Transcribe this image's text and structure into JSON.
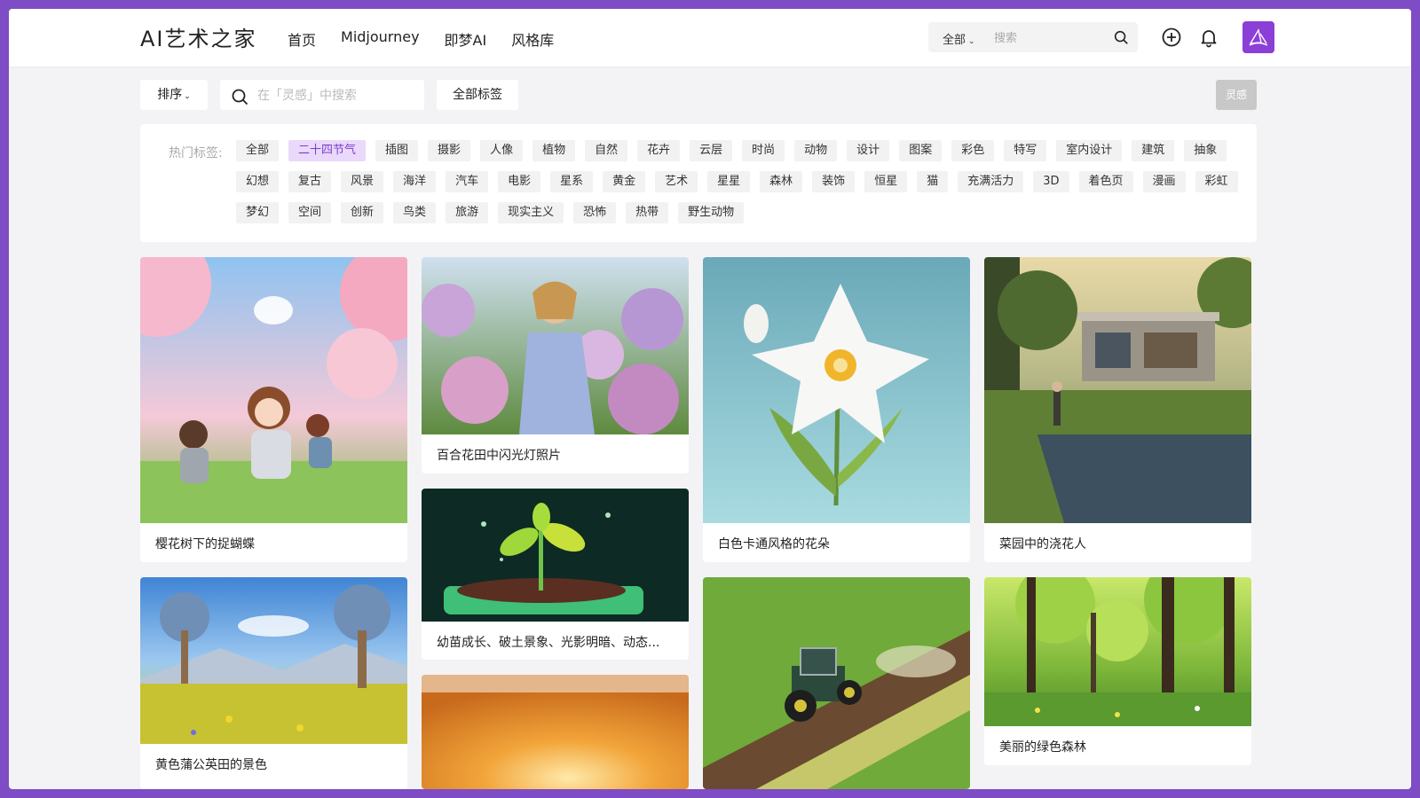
{
  "header": {
    "logo": "AI艺术之家",
    "nav": [
      "首页",
      "Midjourney",
      "即梦AI",
      "风格库"
    ],
    "search_scope": "全部",
    "search_placeholder": "搜索"
  },
  "toolbar": {
    "sort_label": "排序",
    "search_placeholder": "在「灵感」中搜索",
    "all_tags_label": "全部标签",
    "inspire_label": "灵感"
  },
  "tags": {
    "label": "热门标签:",
    "active": "二十四节气",
    "items": [
      "全部",
      "二十四节气",
      "插图",
      "摄影",
      "人像",
      "植物",
      "自然",
      "花卉",
      "云层",
      "时尚",
      "动物",
      "设计",
      "图案",
      "彩色",
      "特写",
      "室内设计",
      "建筑",
      "抽象",
      "幻想",
      "复古",
      "风景",
      "海洋",
      "汽车",
      "电影",
      "星系",
      "黄金",
      "艺术",
      "星星",
      "森林",
      "装饰",
      "恒星",
      "猫",
      "充满活力",
      "3D",
      "着色页",
      "漫画",
      "彩虹",
      "梦幻",
      "空间",
      "创新",
      "鸟类",
      "旅游",
      "现实主义",
      "恐怖",
      "热带",
      "野生动物"
    ]
  },
  "cards": [
    {
      "caption": "樱花树下的捉蝴蝶",
      "image": "cherry-blossom-children"
    },
    {
      "caption": "百合花田中闪光灯照片",
      "image": "woman-hydrangea-field"
    },
    {
      "caption": "幼苗成长、破土景象、光影明暗、动态...",
      "image": "seedling-on-phone"
    },
    {
      "caption": "",
      "image": "golden-sunlight-rain"
    },
    {
      "caption": "白色卡通风格的花朵",
      "image": "white-cartoon-flower"
    },
    {
      "caption": "",
      "image": "tractor-in-field"
    },
    {
      "caption": "菜园中的浇花人",
      "image": "garden-house-gardener"
    },
    {
      "caption": "美丽的绿色森林",
      "image": "green-forest"
    },
    {
      "caption": "黄色蒲公英田的景色",
      "image": "dandelion-field"
    }
  ],
  "colors": {
    "accent": "#7b3fc9",
    "frame": "#7e4cc4",
    "tag_bg": "#f2f2f2"
  }
}
